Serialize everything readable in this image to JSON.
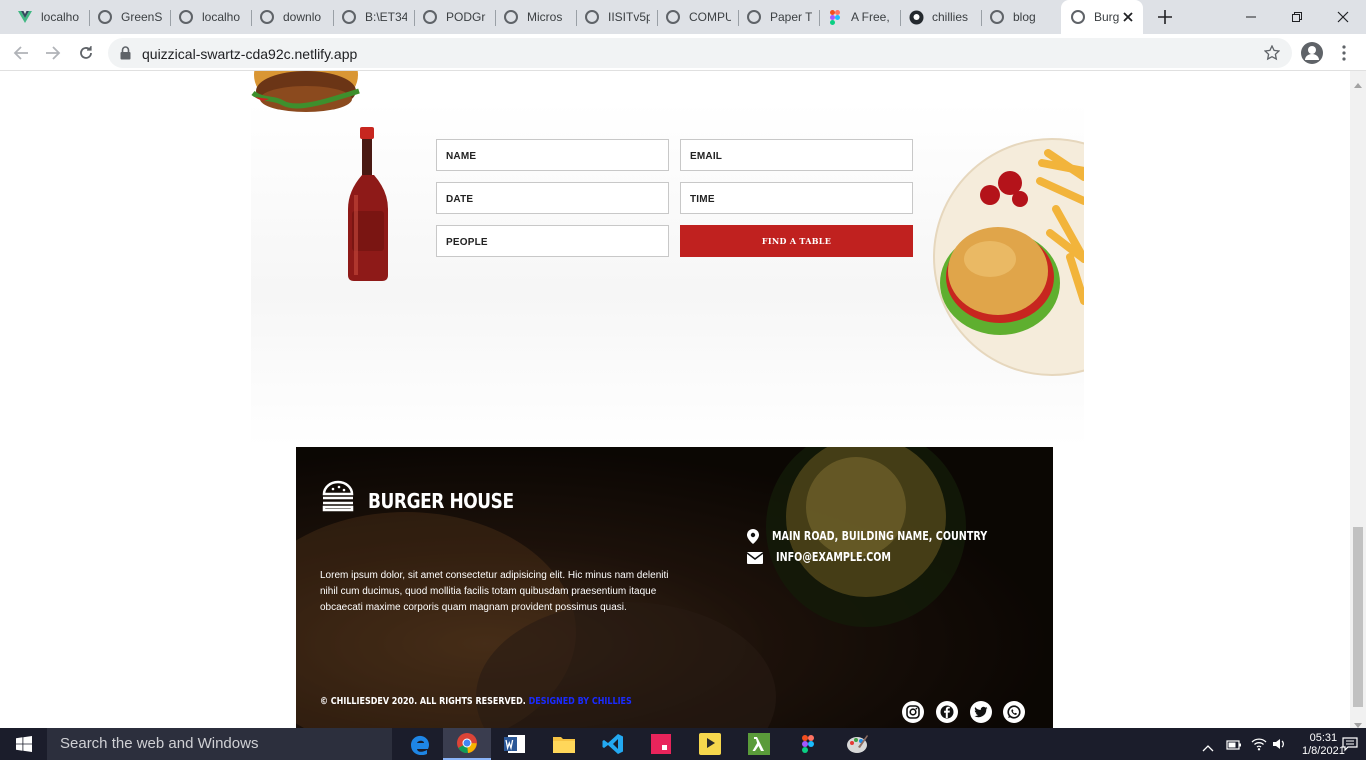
{
  "browser": {
    "tabs": [
      {
        "label": "localho",
        "icon": "vue-icon"
      },
      {
        "label": "GreenS",
        "icon": "globe-icon"
      },
      {
        "label": "localho",
        "icon": "globe-icon"
      },
      {
        "label": "downlo",
        "icon": "globe-icon"
      },
      {
        "label": "B:\\ET34",
        "icon": "globe-icon"
      },
      {
        "label": "PODGr",
        "icon": "globe-icon"
      },
      {
        "label": "Micros",
        "icon": "globe-icon"
      },
      {
        "label": "IISITv5p",
        "icon": "globe-icon"
      },
      {
        "label": "COMPU",
        "icon": "globe-icon"
      },
      {
        "label": "Paper T",
        "icon": "globe-icon"
      },
      {
        "label": "A Free,",
        "icon": "figma-icon"
      },
      {
        "label": "chillies",
        "icon": "github-icon"
      },
      {
        "label": "blog",
        "icon": "globe-icon"
      }
    ],
    "active_tab": {
      "label": "Burg",
      "icon": "globe-icon"
    },
    "url": "quizzical-swartz-cda92c.netlify.app"
  },
  "reservation": {
    "name_placeholder": "NAME",
    "email_placeholder": "EMAIL",
    "date_placeholder": "DATE",
    "time_placeholder": "TIME",
    "people_placeholder": "PEOPLE",
    "submit_label": "FIND A TABLE",
    "accent_color": "#c0211f"
  },
  "footer": {
    "brand": "BURGER HOUSE",
    "about": "Lorem ipsum dolor, sit amet consectetur adipisicing elit. Hic minus nam deleniti nihil cum ducimus, quod mollitia facilis totam quibusdam praesentium itaque obcaecati maxime corporis quam magnam provident possimus quasi.",
    "address": "MAIN ROAD, BUILDING NAME, COUNTRY",
    "email": "INFO@EXAMPLE.COM",
    "copyright": "© CHILLIESDEV 2020. ALL RIGHTS RESERVED.",
    "credit": "DESIGNED BY CHILLIES",
    "socials": [
      "instagram-icon",
      "facebook-icon",
      "twitter-icon",
      "whatsapp-icon"
    ]
  },
  "taskbar": {
    "search_placeholder": "Search the web and Windows",
    "time": "05:31",
    "date": "1/8/2021"
  }
}
